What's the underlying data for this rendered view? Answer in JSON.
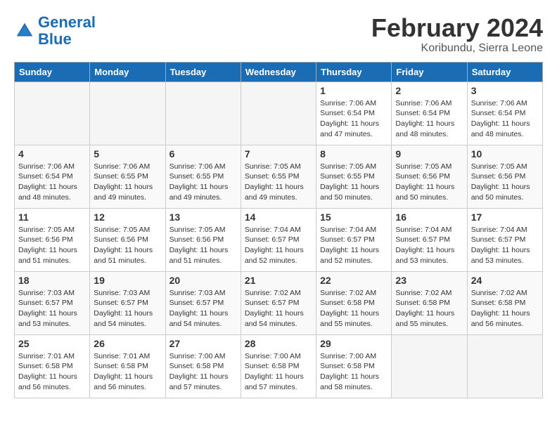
{
  "header": {
    "logo_line1": "General",
    "logo_line2": "Blue",
    "month_year": "February 2024",
    "location": "Koribundu, Sierra Leone"
  },
  "weekdays": [
    "Sunday",
    "Monday",
    "Tuesday",
    "Wednesday",
    "Thursday",
    "Friday",
    "Saturday"
  ],
  "weeks": [
    [
      {
        "day": "",
        "info": ""
      },
      {
        "day": "",
        "info": ""
      },
      {
        "day": "",
        "info": ""
      },
      {
        "day": "",
        "info": ""
      },
      {
        "day": "1",
        "info": "Sunrise: 7:06 AM\nSunset: 6:54 PM\nDaylight: 11 hours\nand 47 minutes."
      },
      {
        "day": "2",
        "info": "Sunrise: 7:06 AM\nSunset: 6:54 PM\nDaylight: 11 hours\nand 48 minutes."
      },
      {
        "day": "3",
        "info": "Sunrise: 7:06 AM\nSunset: 6:54 PM\nDaylight: 11 hours\nand 48 minutes."
      }
    ],
    [
      {
        "day": "4",
        "info": "Sunrise: 7:06 AM\nSunset: 6:54 PM\nDaylight: 11 hours\nand 48 minutes."
      },
      {
        "day": "5",
        "info": "Sunrise: 7:06 AM\nSunset: 6:55 PM\nDaylight: 11 hours\nand 49 minutes."
      },
      {
        "day": "6",
        "info": "Sunrise: 7:06 AM\nSunset: 6:55 PM\nDaylight: 11 hours\nand 49 minutes."
      },
      {
        "day": "7",
        "info": "Sunrise: 7:05 AM\nSunset: 6:55 PM\nDaylight: 11 hours\nand 49 minutes."
      },
      {
        "day": "8",
        "info": "Sunrise: 7:05 AM\nSunset: 6:55 PM\nDaylight: 11 hours\nand 50 minutes."
      },
      {
        "day": "9",
        "info": "Sunrise: 7:05 AM\nSunset: 6:56 PM\nDaylight: 11 hours\nand 50 minutes."
      },
      {
        "day": "10",
        "info": "Sunrise: 7:05 AM\nSunset: 6:56 PM\nDaylight: 11 hours\nand 50 minutes."
      }
    ],
    [
      {
        "day": "11",
        "info": "Sunrise: 7:05 AM\nSunset: 6:56 PM\nDaylight: 11 hours\nand 51 minutes."
      },
      {
        "day": "12",
        "info": "Sunrise: 7:05 AM\nSunset: 6:56 PM\nDaylight: 11 hours\nand 51 minutes."
      },
      {
        "day": "13",
        "info": "Sunrise: 7:05 AM\nSunset: 6:56 PM\nDaylight: 11 hours\nand 51 minutes."
      },
      {
        "day": "14",
        "info": "Sunrise: 7:04 AM\nSunset: 6:57 PM\nDaylight: 11 hours\nand 52 minutes."
      },
      {
        "day": "15",
        "info": "Sunrise: 7:04 AM\nSunset: 6:57 PM\nDaylight: 11 hours\nand 52 minutes."
      },
      {
        "day": "16",
        "info": "Sunrise: 7:04 AM\nSunset: 6:57 PM\nDaylight: 11 hours\nand 53 minutes."
      },
      {
        "day": "17",
        "info": "Sunrise: 7:04 AM\nSunset: 6:57 PM\nDaylight: 11 hours\nand 53 minutes."
      }
    ],
    [
      {
        "day": "18",
        "info": "Sunrise: 7:03 AM\nSunset: 6:57 PM\nDaylight: 11 hours\nand 53 minutes."
      },
      {
        "day": "19",
        "info": "Sunrise: 7:03 AM\nSunset: 6:57 PM\nDaylight: 11 hours\nand 54 minutes."
      },
      {
        "day": "20",
        "info": "Sunrise: 7:03 AM\nSunset: 6:57 PM\nDaylight: 11 hours\nand 54 minutes."
      },
      {
        "day": "21",
        "info": "Sunrise: 7:02 AM\nSunset: 6:57 PM\nDaylight: 11 hours\nand 54 minutes."
      },
      {
        "day": "22",
        "info": "Sunrise: 7:02 AM\nSunset: 6:58 PM\nDaylight: 11 hours\nand 55 minutes."
      },
      {
        "day": "23",
        "info": "Sunrise: 7:02 AM\nSunset: 6:58 PM\nDaylight: 11 hours\nand 55 minutes."
      },
      {
        "day": "24",
        "info": "Sunrise: 7:02 AM\nSunset: 6:58 PM\nDaylight: 11 hours\nand 56 minutes."
      }
    ],
    [
      {
        "day": "25",
        "info": "Sunrise: 7:01 AM\nSunset: 6:58 PM\nDaylight: 11 hours\nand 56 minutes."
      },
      {
        "day": "26",
        "info": "Sunrise: 7:01 AM\nSunset: 6:58 PM\nDaylight: 11 hours\nand 56 minutes."
      },
      {
        "day": "27",
        "info": "Sunrise: 7:00 AM\nSunset: 6:58 PM\nDaylight: 11 hours\nand 57 minutes."
      },
      {
        "day": "28",
        "info": "Sunrise: 7:00 AM\nSunset: 6:58 PM\nDaylight: 11 hours\nand 57 minutes."
      },
      {
        "day": "29",
        "info": "Sunrise: 7:00 AM\nSunset: 6:58 PM\nDaylight: 11 hours\nand 58 minutes."
      },
      {
        "day": "",
        "info": ""
      },
      {
        "day": "",
        "info": ""
      }
    ]
  ]
}
